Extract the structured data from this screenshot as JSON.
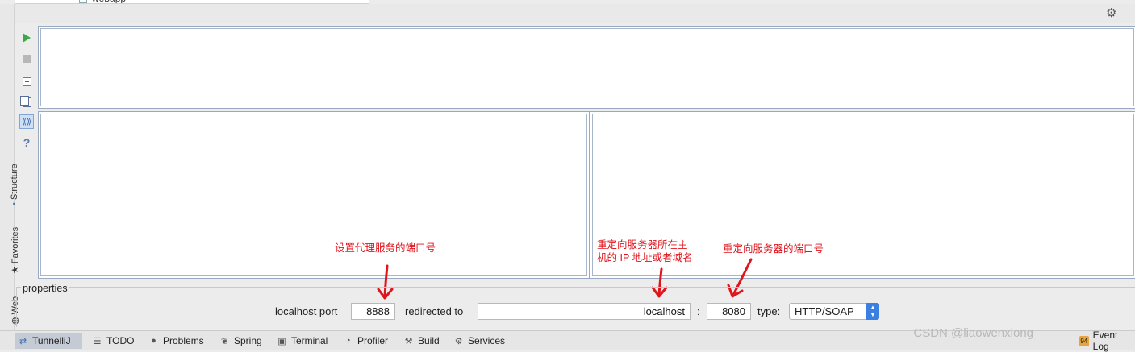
{
  "tree": {
    "item_label": "webapp"
  },
  "left_strip": {
    "tabs": [
      "Structure",
      "Favorites",
      "Web"
    ]
  },
  "properties": {
    "legend": "properties",
    "localhost_port_label": "localhost port",
    "localhost_port_value": "8888",
    "redirected_to_label": "redirected to",
    "redirect_host_value": "localhost",
    "colon": ":",
    "redirect_port_value": "8080",
    "type_label": "type:",
    "type_value": "HTTP/SOAP"
  },
  "annotations": {
    "proxy_port": "设置代理服务的端口号",
    "redirect_host_line1": "重定向服务器所在主",
    "redirect_host_line2": "机的 IP 地址或者域名",
    "redirect_port": "重定向服务器的端口号",
    "arrow_color": "#e0141c"
  },
  "bottom_tabs": [
    "TunnelliJ",
    "TODO",
    "Problems",
    "Spring",
    "Terminal",
    "Profiler",
    "Build",
    "Services"
  ],
  "event_log": "Event Log",
  "event_log_badge": "94",
  "watermark": "CSDN @liaowenxiong",
  "icons": [
    "run-icon",
    "stop-icon",
    "clear-icon",
    "copy-icon",
    "wrap-icon",
    "help-icon",
    "gear-icon",
    "minimize-icon"
  ]
}
